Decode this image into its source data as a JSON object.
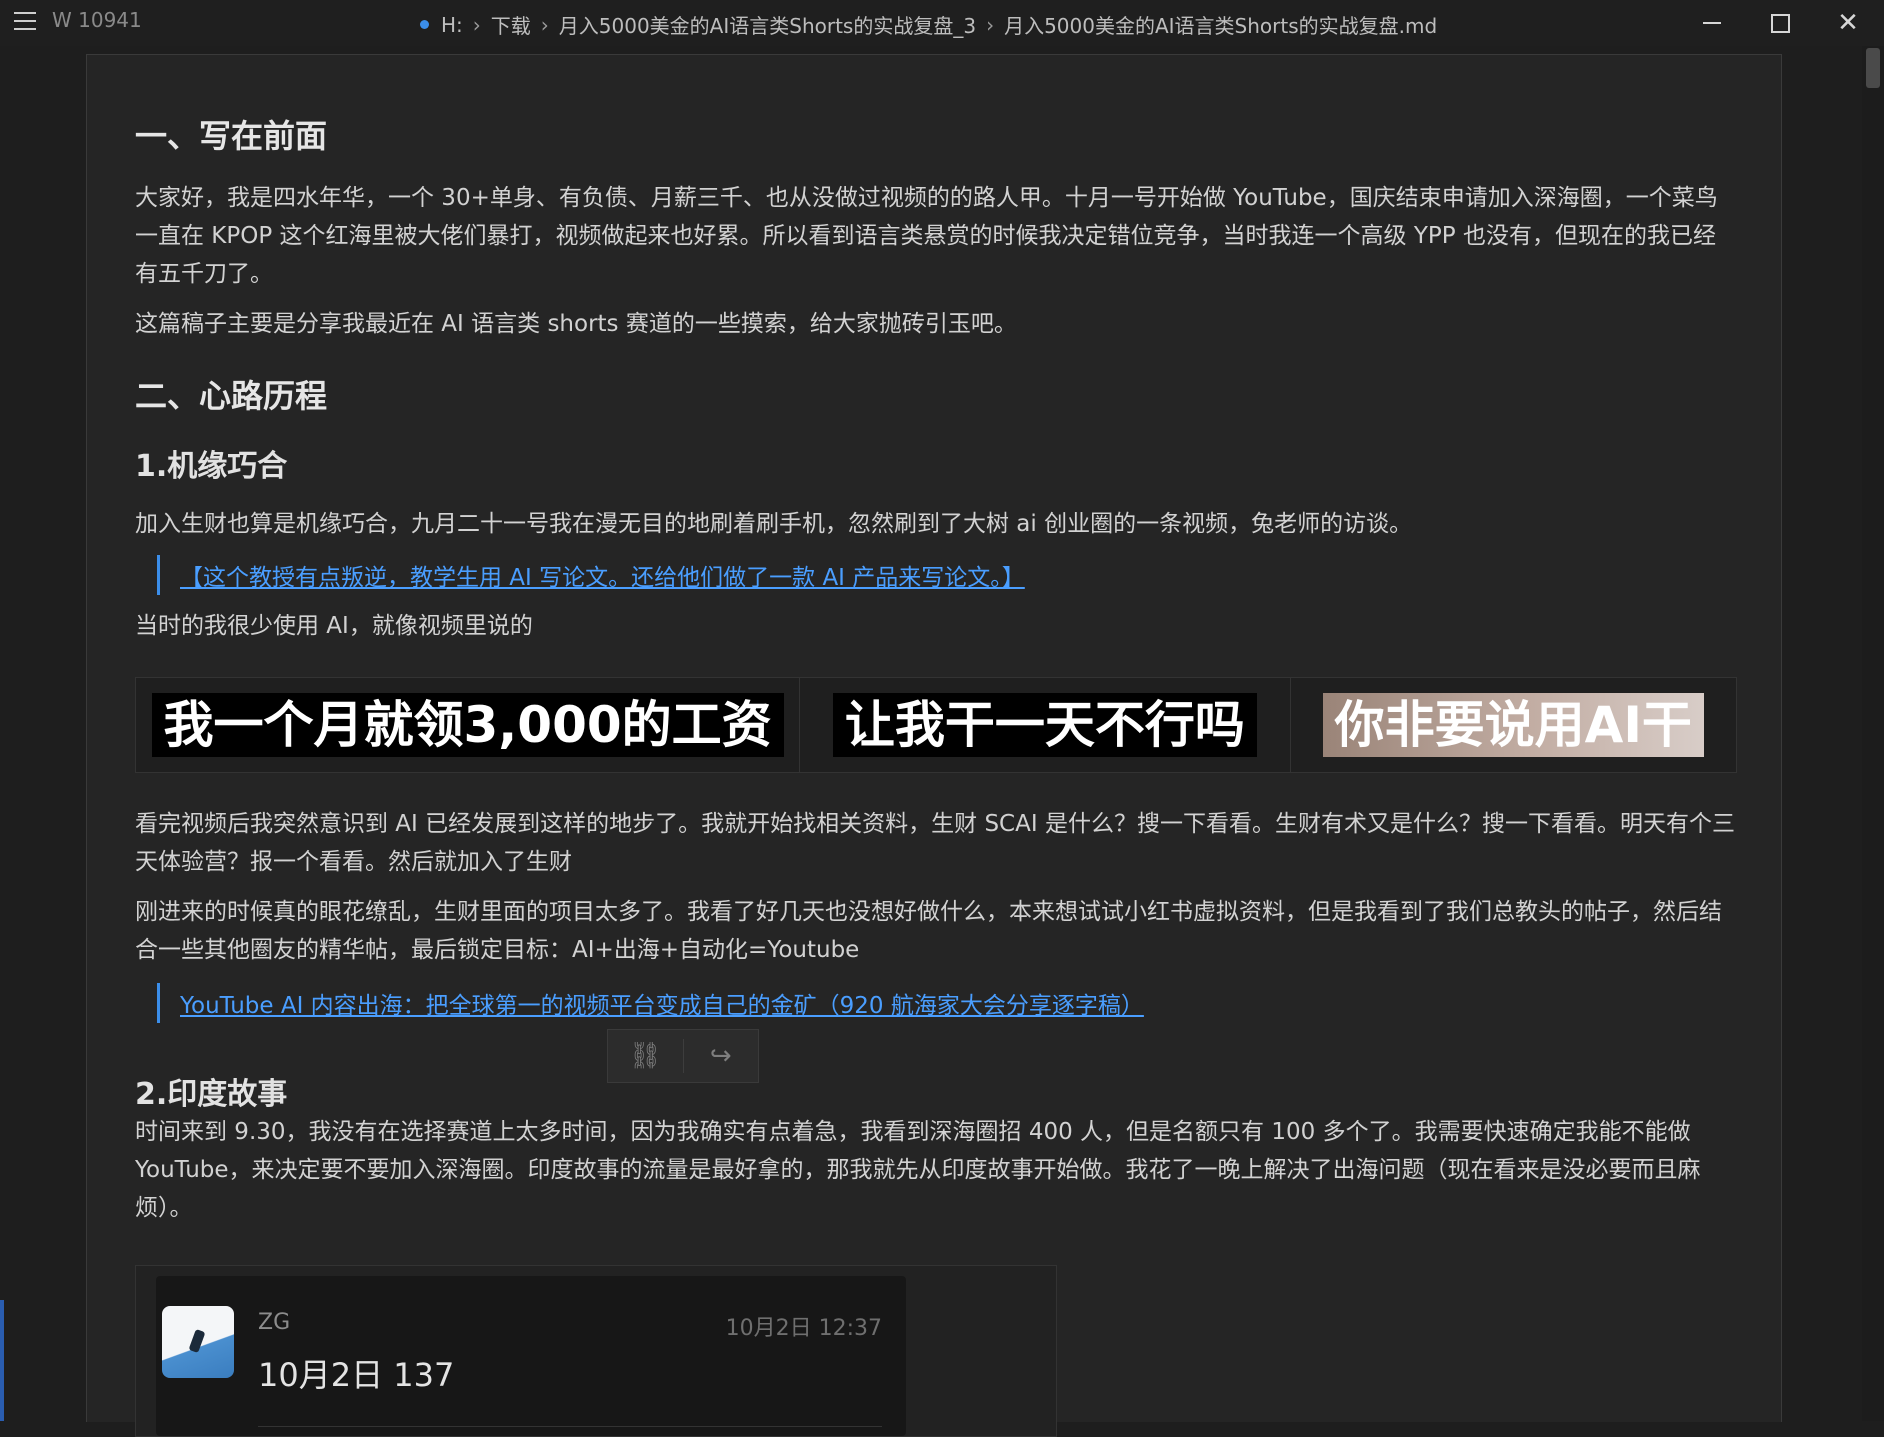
{
  "titlebar": {
    "word_count": "W 10941",
    "breadcrumb": [
      "H:",
      "下载",
      "月入5000美金的AI语言类Shorts的实战复盘_3",
      "月入5000美金的AI语言类Shorts的实战复盘.md"
    ],
    "accent": "#3b8eea"
  },
  "doc": {
    "h1_intro": "一、写在前面",
    "p_intro_1": "大家好，我是四水年华，一个 30+单身、有负债、月薪三千、也从没做过视频的的路人甲。十月一号开始做 YouTube，国庆结束申请加入深海圈，一个菜鸟一直在 KPOP 这个红海里被大佬们暴打，视频做起来也好累。所以看到语言类悬赏的时候我决定错位竞争，当时我连一个高级 YPP 也没有，但现在的我已经有五千刀了。",
    "p_intro_2": "这篇稿子主要是分享我最近在 AI 语言类 shorts 赛道的一些摸索，给大家抛砖引玉吧。",
    "h1_journey": "二、心路历程",
    "h2_chance": "1.机缘巧合",
    "p_chance_1": "加入生财也算是机缘巧合，九月二十一号我在漫无目的地刷着刷手机，忽然刷到了大树 ai 创业圈的一条视频，兔老师的访谈。",
    "link_1": "【这个教授有点叛逆，教学生用 AI 写论文。还给他们做了一款 AI 产品来写论文。】",
    "p_chance_2": "当时的我很少使用 AI，就像视频里说的",
    "captions": [
      "我一个月就领3,000的工资",
      "让我干一天不行吗",
      "你非要说用AI干"
    ],
    "p_chance_3": "看完视频后我突然意识到 AI 已经发展到这样的地步了。我就开始找相关资料，生财 SCAI 是什么？搜一下看看。生财有术又是什么？搜一下看看。明天有个三天体验营？报一个看看。然后就加入了生财",
    "p_chance_4": "刚进来的时候真的眼花缭乱，生财里面的项目太多了。我看了好几天也没想好做什么，本来想试试小红书虚拟资料，但是我看到了我们总教头的帖子，然后结合一些其他圈友的精华帖，最后锁定目标：AI+出海+自动化=Youtube",
    "link_2": "YouTube AI 内容出海：把全球第一的视频平台变成自己的金矿（920 航海家大会分享逐字稿）",
    "h2_india": "2.印度故事",
    "p_india_1": "时间来到 9.30，我没有在选择赛道上太多时间，因为我确实有点着急，我看到深海圈招 400 人，但是名额只有 100 多个了。我需要快速确定我能不能做 YouTube，来决定要不要加入深海圈。印度故事的流量是最好拿的，那我就先从印度故事开始做。我花了一晚上解决了出海问题（现在看来是没必要而且麻烦）。",
    "card": {
      "name": "ZG",
      "time": "10月2日 12:37",
      "message": "10月2日 137"
    }
  }
}
